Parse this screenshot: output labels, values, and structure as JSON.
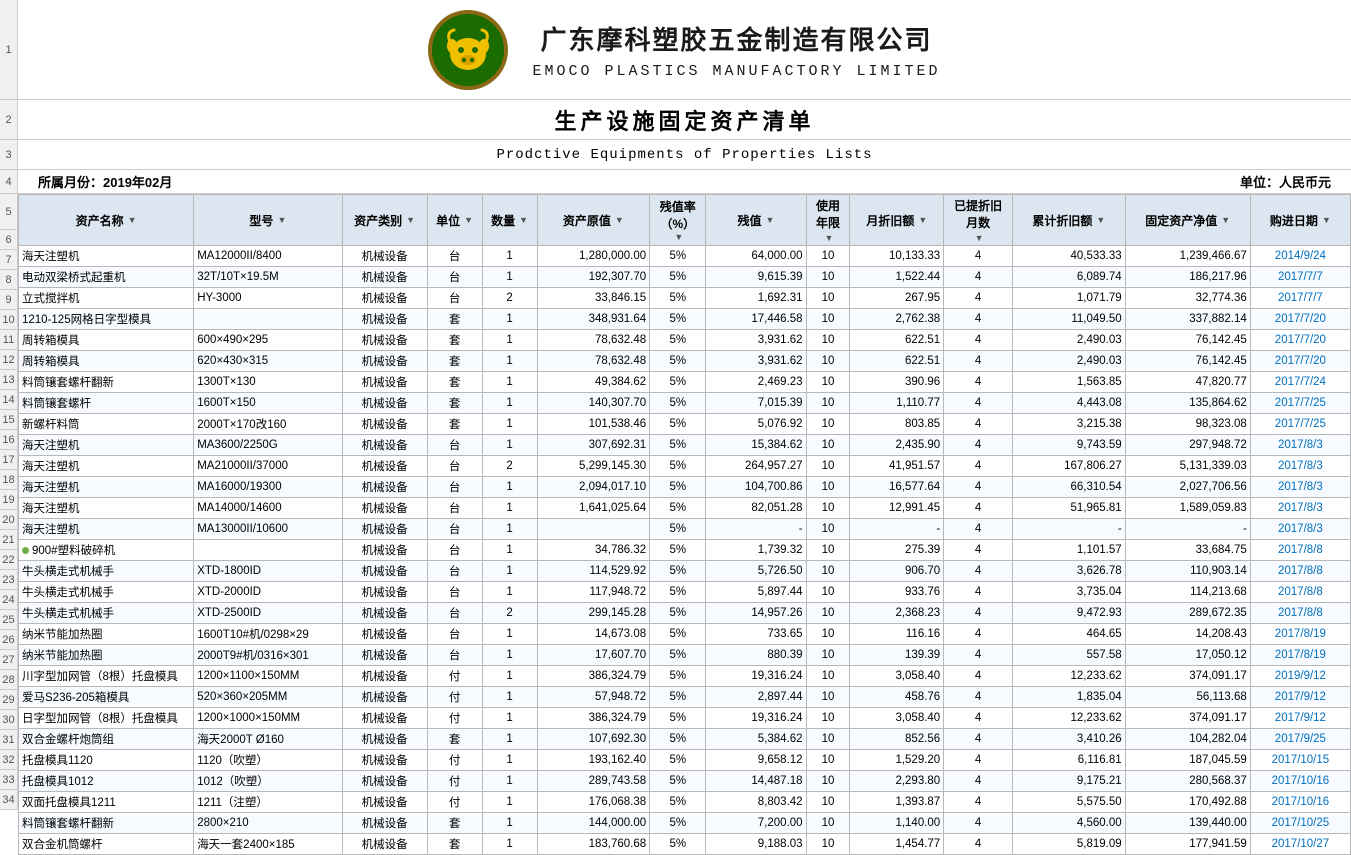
{
  "company": {
    "cn_name": "广东摩科塑胶五金制造有限公司",
    "en_name": "EMOCO PLASTICS MANUFACTORY LIMITED",
    "main_title": "生产设施固定资产清单",
    "sub_title": "Prodctive Equipments of Properties Lists",
    "period_label": "所属月份：2019年02月",
    "unit_label": "单位：人民币元"
  },
  "table_headers": [
    "资产名称",
    "型号",
    "资产类别",
    "单位",
    "数量",
    "资产原值",
    "残值率（%）",
    "残值",
    "使用年限",
    "月折旧额",
    "已提折旧月数",
    "累计折旧额",
    "固定资产净值",
    "购进日期"
  ],
  "rows": [
    {
      "no": 6,
      "name": "海天注塑机",
      "model": "MA12000II/8400",
      "type": "机械设备",
      "unit": "台",
      "qty": 1,
      "original": "1,280,000.00",
      "rate": "5%",
      "residual": "64,000.00",
      "years": 10,
      "monthly": "10,133.33",
      "months": 4,
      "accumulated": "40,533.33",
      "net": "1,239,466.67",
      "date": "2014/9/24"
    },
    {
      "no": 7,
      "name": "电动双梁桥式起重机",
      "model": "32T/10T×19.5M",
      "type": "机械设备",
      "unit": "台",
      "qty": 1,
      "original": "192,307.70",
      "rate": "5%",
      "residual": "9,615.39",
      "years": 10,
      "monthly": "1,522.44",
      "months": 4,
      "accumulated": "6,089.74",
      "net": "186,217.96",
      "date": "2017/7/7"
    },
    {
      "no": 8,
      "name": "立式搅拌机",
      "model": "HY-3000",
      "type": "机械设备",
      "unit": "台",
      "qty": 2,
      "original": "33,846.15",
      "rate": "5%",
      "residual": "1,692.31",
      "years": 10,
      "monthly": "267.95",
      "months": 4,
      "accumulated": "1,071.79",
      "net": "32,774.36",
      "date": "2017/7/7"
    },
    {
      "no": 9,
      "name": "1210-125网格日字型模具",
      "model": "",
      "type": "机械设备",
      "unit": "套",
      "qty": 1,
      "original": "348,931.64",
      "rate": "5%",
      "residual": "17,446.58",
      "years": 10,
      "monthly": "2,762.38",
      "months": 4,
      "accumulated": "11,049.50",
      "net": "337,882.14",
      "date": "2017/7/20"
    },
    {
      "no": 10,
      "name": "周转箱模具",
      "model": "600×490×295",
      "type": "机械设备",
      "unit": "套",
      "qty": 1,
      "original": "78,632.48",
      "rate": "5%",
      "residual": "3,931.62",
      "years": 10,
      "monthly": "622.51",
      "months": 4,
      "accumulated": "2,490.03",
      "net": "76,142.45",
      "date": "2017/7/20"
    },
    {
      "no": 11,
      "name": "周转箱模具",
      "model": "620×430×315",
      "type": "机械设备",
      "unit": "套",
      "qty": 1,
      "original": "78,632.48",
      "rate": "5%",
      "residual": "3,931.62",
      "years": 10,
      "monthly": "622.51",
      "months": 4,
      "accumulated": "2,490.03",
      "net": "76,142.45",
      "date": "2017/7/20"
    },
    {
      "no": 12,
      "name": "料筒镶套螺杆翻新",
      "model": "1300T×130",
      "type": "机械设备",
      "unit": "套",
      "qty": 1,
      "original": "49,384.62",
      "rate": "5%",
      "residual": "2,469.23",
      "years": 10,
      "monthly": "390.96",
      "months": 4,
      "accumulated": "1,563.85",
      "net": "47,820.77",
      "date": "2017/7/24"
    },
    {
      "no": 13,
      "name": "料筒镶套螺杆",
      "model": "1600T×150",
      "type": "机械设备",
      "unit": "套",
      "qty": 1,
      "original": "140,307.70",
      "rate": "5%",
      "residual": "7,015.39",
      "years": 10,
      "monthly": "1,110.77",
      "months": 4,
      "accumulated": "4,443.08",
      "net": "135,864.62",
      "date": "2017/7/25"
    },
    {
      "no": 14,
      "name": "新螺杆料筒",
      "model": "2000T×170改160",
      "type": "机械设备",
      "unit": "套",
      "qty": 1,
      "original": "101,538.46",
      "rate": "5%",
      "residual": "5,076.92",
      "years": 10,
      "monthly": "803.85",
      "months": 4,
      "accumulated": "3,215.38",
      "net": "98,323.08",
      "date": "2017/7/25"
    },
    {
      "no": 15,
      "name": "海天注塑机",
      "model": "MA3600/2250G",
      "type": "机械设备",
      "unit": "台",
      "qty": 1,
      "original": "307,692.31",
      "rate": "5%",
      "residual": "15,384.62",
      "years": 10,
      "monthly": "2,435.90",
      "months": 4,
      "accumulated": "9,743.59",
      "net": "297,948.72",
      "date": "2017/8/3"
    },
    {
      "no": 16,
      "name": "海天注塑机",
      "model": "MA21000II/37000",
      "type": "机械设备",
      "unit": "台",
      "qty": 2,
      "original": "5,299,145.30",
      "rate": "5%",
      "residual": "264,957.27",
      "years": 10,
      "monthly": "41,951.57",
      "months": 4,
      "accumulated": "167,806.27",
      "net": "5,131,339.03",
      "date": "2017/8/3"
    },
    {
      "no": 17,
      "name": "海天注塑机",
      "model": "MA16000/19300",
      "type": "机械设备",
      "unit": "台",
      "qty": 1,
      "original": "2,094,017.10",
      "rate": "5%",
      "residual": "104,700.86",
      "years": 10,
      "monthly": "16,577.64",
      "months": 4,
      "accumulated": "66,310.54",
      "net": "2,027,706.56",
      "date": "2017/8/3"
    },
    {
      "no": 18,
      "name": "海天注塑机",
      "model": "MA14000/14600",
      "type": "机械设备",
      "unit": "台",
      "qty": 1,
      "original": "1,641,025.64",
      "rate": "5%",
      "residual": "82,051.28",
      "years": 10,
      "monthly": "12,991.45",
      "months": 4,
      "accumulated": "51,965.81",
      "net": "1,589,059.83",
      "date": "2017/8/3"
    },
    {
      "no": 19,
      "name": "海天注塑机",
      "model": "MA13000II/10600",
      "type": "机械设备",
      "unit": "台",
      "qty": 1,
      "original": "",
      "rate": "5%",
      "residual": "-",
      "years": 10,
      "monthly": "-",
      "months": 4,
      "accumulated": "-",
      "net": "-",
      "date": "2017/8/3"
    },
    {
      "no": 20,
      "name": "900#塑料破碎机",
      "model": "",
      "type": "机械设备",
      "unit": "台",
      "qty": 1,
      "original": "34,786.32",
      "rate": "5%",
      "residual": "1,739.32",
      "years": 10,
      "monthly": "275.39",
      "months": 4,
      "accumulated": "1,101.57",
      "net": "33,684.75",
      "date": "2017/8/8"
    },
    {
      "no": 21,
      "name": "牛头横走式机械手",
      "model": "XTD-1800ID",
      "type": "机械设备",
      "unit": "台",
      "qty": 1,
      "original": "114,529.92",
      "rate": "5%",
      "residual": "5,726.50",
      "years": 10,
      "monthly": "906.70",
      "months": 4,
      "accumulated": "3,626.78",
      "net": "110,903.14",
      "date": "2017/8/8"
    },
    {
      "no": 22,
      "name": "牛头横走式机械手",
      "model": "XTD-2000ID",
      "type": "机械设备",
      "unit": "台",
      "qty": 1,
      "original": "117,948.72",
      "rate": "5%",
      "residual": "5,897.44",
      "years": 10,
      "monthly": "933.76",
      "months": 4,
      "accumulated": "3,735.04",
      "net": "114,213.68",
      "date": "2017/8/8"
    },
    {
      "no": 23,
      "name": "牛头横走式机械手",
      "model": "XTD-2500ID",
      "type": "机械设备",
      "unit": "台",
      "qty": 2,
      "original": "299,145.28",
      "rate": "5%",
      "residual": "14,957.26",
      "years": 10,
      "monthly": "2,368.23",
      "months": 4,
      "accumulated": "9,472.93",
      "net": "289,672.35",
      "date": "2017/8/8"
    },
    {
      "no": 24,
      "name": "纳米节能加热圈",
      "model": "1600T10#机/0298×29",
      "type": "机械设备",
      "unit": "台",
      "qty": 1,
      "original": "14,673.08",
      "rate": "5%",
      "residual": "733.65",
      "years": 10,
      "monthly": "116.16",
      "months": 4,
      "accumulated": "464.65",
      "net": "14,208.43",
      "date": "2017/8/19"
    },
    {
      "no": 25,
      "name": "纳米节能加热圈",
      "model": "2000T9#机/0316×301",
      "type": "机械设备",
      "unit": "台",
      "qty": 1,
      "original": "17,607.70",
      "rate": "5%",
      "residual": "880.39",
      "years": 10,
      "monthly": "139.39",
      "months": 4,
      "accumulated": "557.58",
      "net": "17,050.12",
      "date": "2017/8/19"
    },
    {
      "no": 26,
      "name": "川字型加网管（8根）托盘模具",
      "model": "1200×1100×150MM",
      "type": "机械设备",
      "unit": "付",
      "qty": 1,
      "original": "386,324.79",
      "rate": "5%",
      "residual": "19,316.24",
      "years": 10,
      "monthly": "3,058.40",
      "months": 4,
      "accumulated": "12,233.62",
      "net": "374,091.17",
      "date": "2019/9/12"
    },
    {
      "no": 27,
      "name": "爱马S236-205箱模具",
      "model": "520×360×205MM",
      "type": "机械设备",
      "unit": "付",
      "qty": 1,
      "original": "57,948.72",
      "rate": "5%",
      "residual": "2,897.44",
      "years": 10,
      "monthly": "458.76",
      "months": 4,
      "accumulated": "1,835.04",
      "net": "56,113.68",
      "date": "2017/9/12"
    },
    {
      "no": 28,
      "name": "日字型加网管（8根）托盘模具",
      "model": "1200×1000×150MM",
      "type": "机械设备",
      "unit": "付",
      "qty": 1,
      "original": "386,324.79",
      "rate": "5%",
      "residual": "19,316.24",
      "years": 10,
      "monthly": "3,058.40",
      "months": 4,
      "accumulated": "12,233.62",
      "net": "374,091.17",
      "date": "2017/9/12"
    },
    {
      "no": 29,
      "name": "双合金螺杆炮筒组",
      "model": "海天2000T Ø160",
      "type": "机械设备",
      "unit": "套",
      "qty": 1,
      "original": "107,692.30",
      "rate": "5%",
      "residual": "5,384.62",
      "years": 10,
      "monthly": "852.56",
      "months": 4,
      "accumulated": "3,410.26",
      "net": "104,282.04",
      "date": "2017/9/25"
    },
    {
      "no": 30,
      "name": "托盘模具1120",
      "model": "1120（吹塑）",
      "type": "机械设备",
      "unit": "付",
      "qty": 1,
      "original": "193,162.40",
      "rate": "5%",
      "residual": "9,658.12",
      "years": 10,
      "monthly": "1,529.20",
      "months": 4,
      "accumulated": "6,116.81",
      "net": "187,045.59",
      "date": "2017/10/15"
    },
    {
      "no": 31,
      "name": "托盘模具1012",
      "model": "1012（吹塑）",
      "type": "机械设备",
      "unit": "付",
      "qty": 1,
      "original": "289,743.58",
      "rate": "5%",
      "residual": "14,487.18",
      "years": 10,
      "monthly": "2,293.80",
      "months": 4,
      "accumulated": "9,175.21",
      "net": "280,568.37",
      "date": "2017/10/16"
    },
    {
      "no": 32,
      "name": "双面托盘模具1211",
      "model": "1211（注塑）",
      "type": "机械设备",
      "unit": "付",
      "qty": 1,
      "original": "176,068.38",
      "rate": "5%",
      "residual": "8,803.42",
      "years": 10,
      "monthly": "1,393.87",
      "months": 4,
      "accumulated": "5,575.50",
      "net": "170,492.88",
      "date": "2017/10/16"
    },
    {
      "no": 33,
      "name": "料筒镶套螺杆翻新",
      "model": "2800×210",
      "type": "机械设备",
      "unit": "套",
      "qty": 1,
      "original": "144,000.00",
      "rate": "5%",
      "residual": "7,200.00",
      "years": 10,
      "monthly": "1,140.00",
      "months": 4,
      "accumulated": "4,560.00",
      "net": "139,440.00",
      "date": "2017/10/25"
    },
    {
      "no": 34,
      "name": "双合金机筒螺杆",
      "model": "海天一套2400×185",
      "type": "机械设备",
      "unit": "套",
      "qty": 1,
      "original": "183,760.68",
      "rate": "5%",
      "residual": "9,188.03",
      "years": 10,
      "monthly": "1,454.77",
      "months": 4,
      "accumulated": "5,819.09",
      "net": "177,941.59",
      "date": "2017/10/27"
    }
  ]
}
